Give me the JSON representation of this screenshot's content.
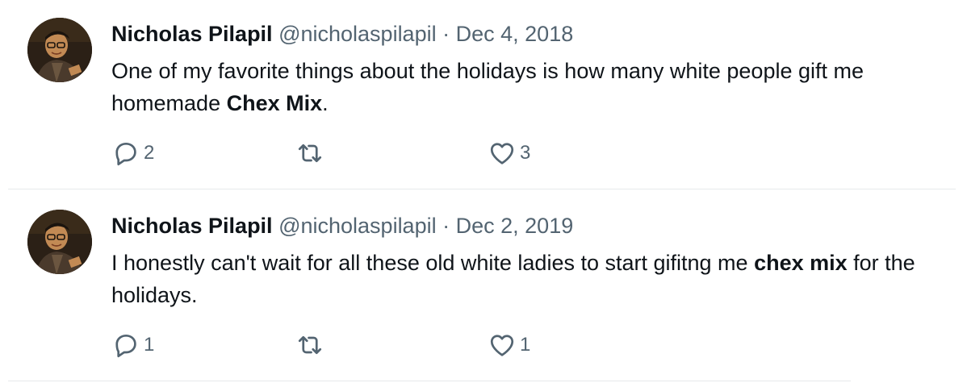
{
  "tweets": [
    {
      "author": "Nicholas Pilapil",
      "handle": "@nicholaspilapil",
      "separator": "·",
      "date": "Dec 4, 2018",
      "text_before": "One of my favorite things about the holidays is how many white people gift me homemade ",
      "bold_1": "Chex Mix",
      "text_middle": ".",
      "bold_2": "",
      "text_after": "",
      "replies": "2",
      "retweets": "",
      "likes": "3"
    },
    {
      "author": "Nicholas Pilapil",
      "handle": "@nicholaspilapil",
      "separator": "·",
      "date": "Dec 2, 2019",
      "text_before": "I honestly can't wait for all these old white ladies to start gifitng me ",
      "bold_1": "chex mix",
      "text_middle": " for the holidays.",
      "bold_2": "",
      "text_after": "",
      "replies": "1",
      "retweets": "",
      "likes": "1"
    }
  ],
  "icons": {
    "reply": "reply-icon",
    "retweet": "retweet-icon",
    "like": "heart-icon"
  },
  "colors": {
    "text": "#0f1419",
    "secondary": "#536471",
    "divider": "#e6e9eb"
  }
}
